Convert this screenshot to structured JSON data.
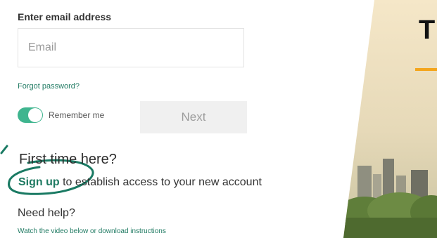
{
  "login": {
    "email_label": "Enter email address",
    "email_placeholder": "Email",
    "email_value": "",
    "forgot_password": "Forgot password?",
    "remember_me": "Remember me",
    "remember_on": true,
    "next_label": "Next"
  },
  "signup": {
    "heading": "First time here?",
    "link": "Sign up",
    "text": " to establish access to your new account"
  },
  "help": {
    "heading": "Need help?",
    "link": "Watch the video below or download instructions"
  },
  "hero": {
    "heading_fragment": "T"
  },
  "colors": {
    "accent_green": "#1f7a62",
    "toggle_green": "#3fb58f",
    "accent_orange": "#f4a51c",
    "annotation_green": "#1a7a63"
  }
}
